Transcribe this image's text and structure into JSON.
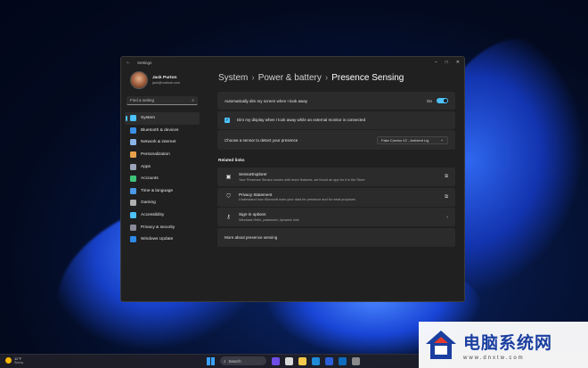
{
  "window": {
    "title": "Settings"
  },
  "user": {
    "name": "Jack Purton",
    "email": "jack@outlook.com"
  },
  "search": {
    "placeholder": "Find a setting"
  },
  "sidebar": {
    "items": [
      {
        "label": "System",
        "icon": "system-icon",
        "color": "#4cc2ff",
        "active": true
      },
      {
        "label": "Bluetooth & devices",
        "icon": "bluetooth-icon",
        "color": "#3a8ee6"
      },
      {
        "label": "Network & internet",
        "icon": "network-icon",
        "color": "#8ab4e8"
      },
      {
        "label": "Personalization",
        "icon": "brush-icon",
        "color": "#e8a04c"
      },
      {
        "label": "Apps",
        "icon": "apps-icon",
        "color": "#9aa6b8"
      },
      {
        "label": "Accounts",
        "icon": "accounts-icon",
        "color": "#3ec47a"
      },
      {
        "label": "Time & language",
        "icon": "globe-clock-icon",
        "color": "#4a9ae8"
      },
      {
        "label": "Gaming",
        "icon": "gamepad-icon",
        "color": "#b0b0b0"
      },
      {
        "label": "Accessibility",
        "icon": "accessibility-icon",
        "color": "#4cc2ff"
      },
      {
        "label": "Privacy & security",
        "icon": "shield-icon",
        "color": "#8a8a9a"
      },
      {
        "label": "Windows Update",
        "icon": "update-icon",
        "color": "#2f8ae8"
      }
    ]
  },
  "breadcrumb": {
    "part1": "System",
    "part2": "Power & battery",
    "current": "Presence Sensing"
  },
  "settings": {
    "dim_label": "Automatically dim my screen when I look away",
    "dim_value": "On",
    "dim_external_label": "Dim my display when I look away while an external monitor is connected",
    "sensor_label": "Choose a sensor to detect your presence",
    "sensor_value": "Fake Combo V2 - Ambient Lig"
  },
  "related": {
    "title": "Related links",
    "links": [
      {
        "title": "SensorExplorer",
        "desc": "Your Presence Sensor comes with more features, we found an app for it in the Store"
      },
      {
        "title": "Privacy Statement",
        "desc": "Understand how Microsoft uses your data for presence and for what purposes"
      },
      {
        "title": "Sign-in options",
        "desc": "Windows Hello, password, dynamic lock"
      }
    ],
    "more": "More about presence sensing"
  },
  "taskbar": {
    "temp": "11°F",
    "condition": "Sunny",
    "search": "Search"
  },
  "watermark": {
    "brand": "电脑系统网",
    "url": "www.dnxtw.com"
  }
}
